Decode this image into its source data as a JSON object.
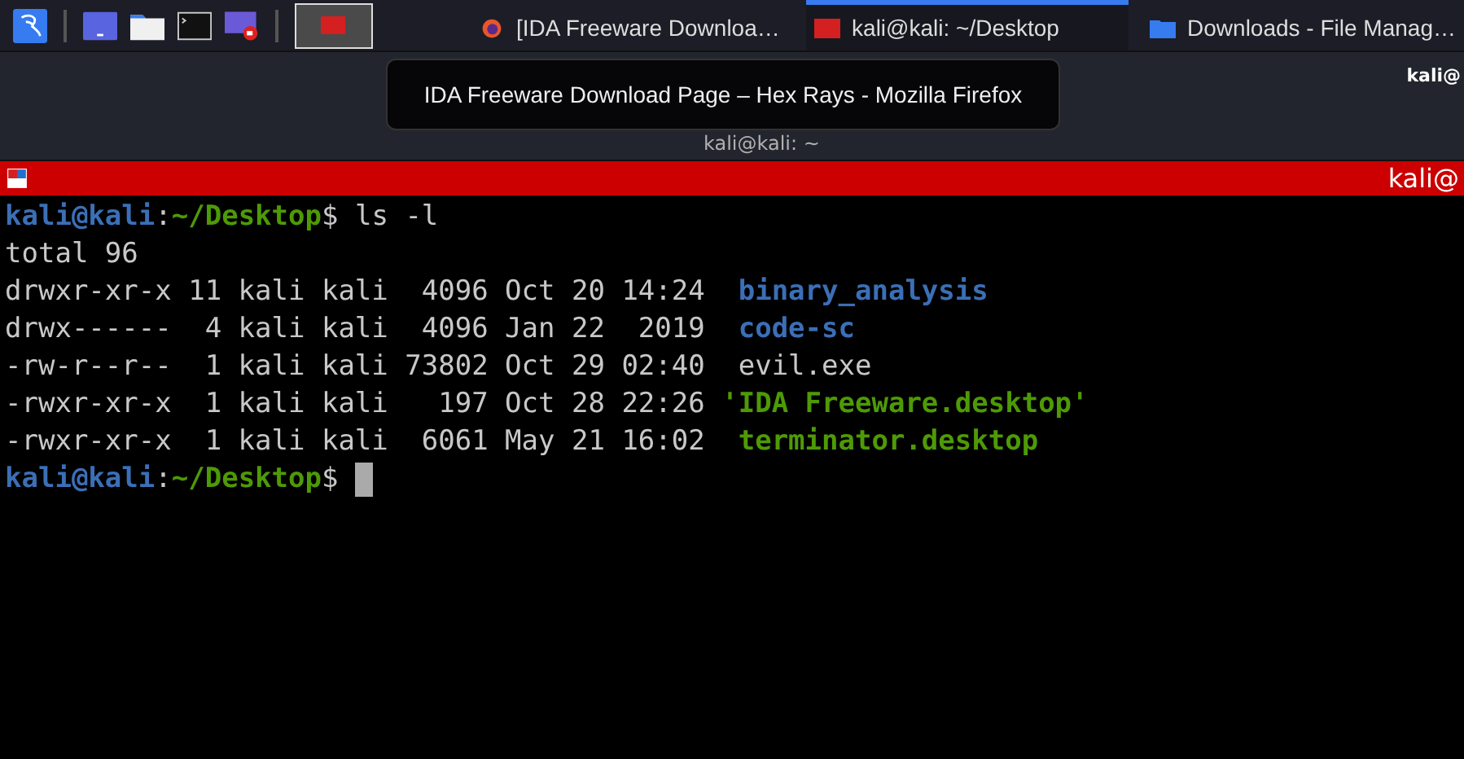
{
  "taskbar": {
    "workspaces": [
      {
        "selected": true
      }
    ],
    "tasks": [
      {
        "kind": "browser",
        "label": "[IDA Freeware Downloa…",
        "selected": false
      },
      {
        "kind": "terminal",
        "label": "kali@kali: ~/Desktop",
        "selected": true
      },
      {
        "kind": "files",
        "label": "Downloads - File Manag…",
        "selected": false
      }
    ]
  },
  "tooltip": "IDA Freeware Download Page – Hex Rays - Mozilla Firefox",
  "back_window": {
    "title": "kali@kali: ~",
    "right_title": "kali@"
  },
  "terminal": {
    "title": "kali@",
    "lines": [
      {
        "kind": "prompt",
        "user": "kali@kali",
        "sep": ":",
        "path": "~/Desktop",
        "dollar": "$",
        "command": "ls -l"
      },
      {
        "kind": "text",
        "text": "total 96"
      },
      {
        "kind": "dir",
        "meta": "drwxr-xr-x 11 kali kali  4096 Oct 20 14:24  ",
        "name": "binary_analysis"
      },
      {
        "kind": "dir",
        "meta": "drwx------  4 kali kali  4096 Jan 22  2019  ",
        "name": "code-sc"
      },
      {
        "kind": "file",
        "meta": "-rw-r--r--  1 kali kali 73802 Oct 29 02:40  ",
        "name": "evil.exe"
      },
      {
        "kind": "exec",
        "meta": "-rwxr-xr-x  1 kali kali   197 Oct 28 22:26 ",
        "name": "'IDA Freeware.desktop'"
      },
      {
        "kind": "exec",
        "meta": "-rwxr-xr-x  1 kali kali  6061 May 21 16:02  ",
        "name": "terminator.desktop"
      },
      {
        "kind": "prompt",
        "user": "kali@kali",
        "sep": ":",
        "path": "~/Desktop",
        "dollar": "$",
        "cursor": true
      }
    ]
  }
}
